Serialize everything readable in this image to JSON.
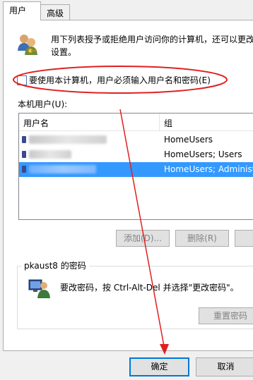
{
  "tabs": [
    {
      "label": "用户",
      "active": true
    },
    {
      "label": "高级",
      "active": false
    }
  ],
  "description_line1": "用下列表授予或拒绝用户访问你的计算机，还可以更改",
  "description_line2": "设置。",
  "require_login": {
    "label": "要使用本计算机，用户必须输入用户名和密码(E)",
    "checked": false
  },
  "local_users_label": "本机用户(U):",
  "table": {
    "columns": [
      "用户名",
      "组"
    ],
    "rows": [
      {
        "group": "HomeUsers",
        "selected": false
      },
      {
        "group": "HomeUsers; Users",
        "selected": false
      },
      {
        "group": "HomeUsers; Administ",
        "selected": true
      }
    ]
  },
  "buttons": {
    "add": "添加(D)...",
    "delete": "删除(R)",
    "reset_password": "重置密码",
    "ok": "确定",
    "cancel": "取消"
  },
  "password_group": {
    "title": "pkaust8 的密码",
    "text": "要改密码，按 Ctrl-Alt-Del 并选择\"更改密码\"。"
  },
  "icons": {
    "users": "users-icon",
    "password_user": "user-monitor-icon"
  },
  "annotation_color": "#e02020"
}
